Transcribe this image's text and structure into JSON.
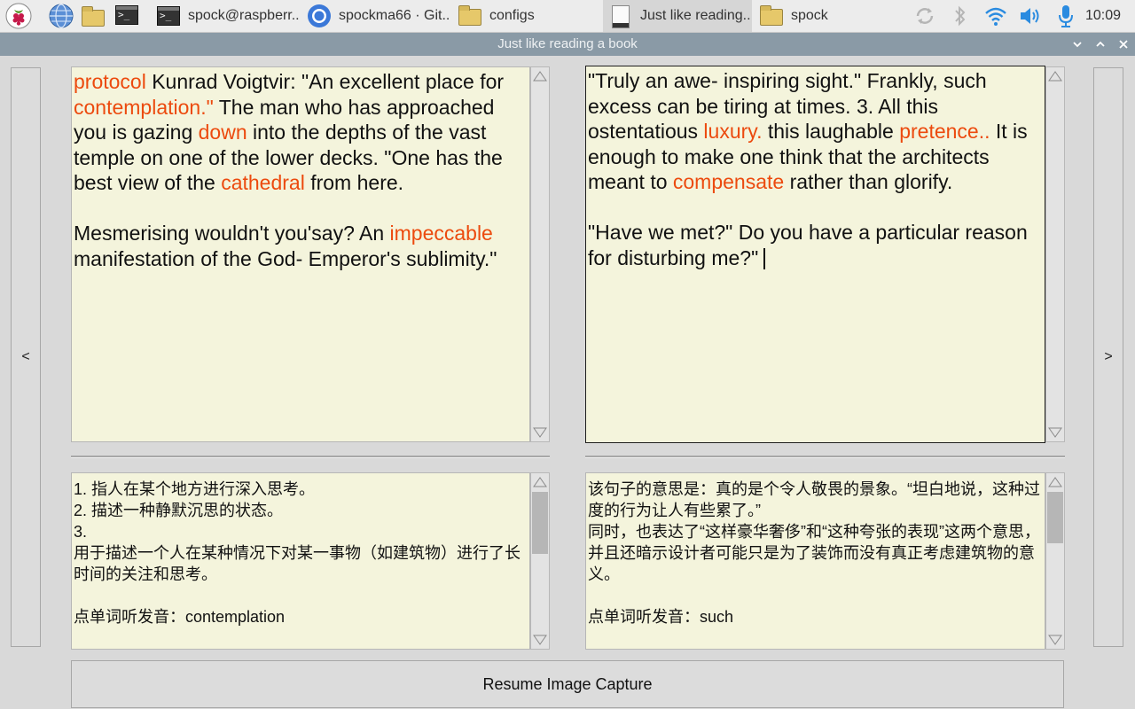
{
  "taskbar": {
    "tasks": [
      {
        "label": "spock@raspberr.."
      },
      {
        "label": "spockma66 · Git.."
      },
      {
        "label": "configs"
      },
      {
        "label": "Just like reading.."
      },
      {
        "label": "spock"
      }
    ],
    "terminal_glyph": ">_",
    "clock": "10:09"
  },
  "window": {
    "title": "Just like reading a book",
    "prev_label": "<",
    "next_label": ">"
  },
  "left_pane": {
    "segments": [
      {
        "t": "protocol",
        "hl": true
      },
      {
        "t": " Kunrad Voigtvir: \"An excellent place for "
      },
      {
        "t": "contemplation.\"",
        "hl": true
      },
      {
        "t": " The man who has approached you is gazing "
      },
      {
        "t": "down",
        "hl": true
      },
      {
        "t": " into the depths of the vast temple on one of the lower decks. \"One has the best view of the "
      },
      {
        "t": "cathedral",
        "hl": true
      },
      {
        "t": " from here.\n\nMesmerising wouldn't you'say? An "
      },
      {
        "t": "impeccable",
        "hl": true
      },
      {
        "t": " manifestation of the God- Emperor's sublimity.\""
      }
    ]
  },
  "right_pane": {
    "segments": [
      {
        "t": "\"Truly an awe- inspiring sight.\" Frankly, such excess can be tiring at times. 3. All this ostentatious "
      },
      {
        "t": "luxury.",
        "hl": true
      },
      {
        "t": " this laughable "
      },
      {
        "t": "pretence..",
        "hl": true
      },
      {
        "t": " It is enough to make one think that the architects meant to "
      },
      {
        "t": "compensate",
        "hl": true
      },
      {
        "t": " rather than glorify.\n\n\"Have we met?\" Do you have a particular reason for disturbing me?\""
      }
    ]
  },
  "left_translation": {
    "text": "1. 指人在某个地方进行深入思考。\n2. 描述一种静默沉思的状态。\n3.\n用于描述一个人在某种情况下对某一事物（如建筑物）进行了长时间的关注和思考。\n\n点单词听发音：contemplation"
  },
  "right_translation": {
    "text": "该句子的意思是：真的是个令人敬畏的景象。“坦白地说，这种过度的行为让人有些累了。”\n同时，也表达了“这样豪华奢侈”和“这种夸张的表现”这两个意思，并且还暗示设计者可能只是为了装饰而没有真正考虑建筑物的意义。\n\n点单词听发音：such"
  },
  "resume_button": {
    "label": "Resume Image Capture"
  }
}
